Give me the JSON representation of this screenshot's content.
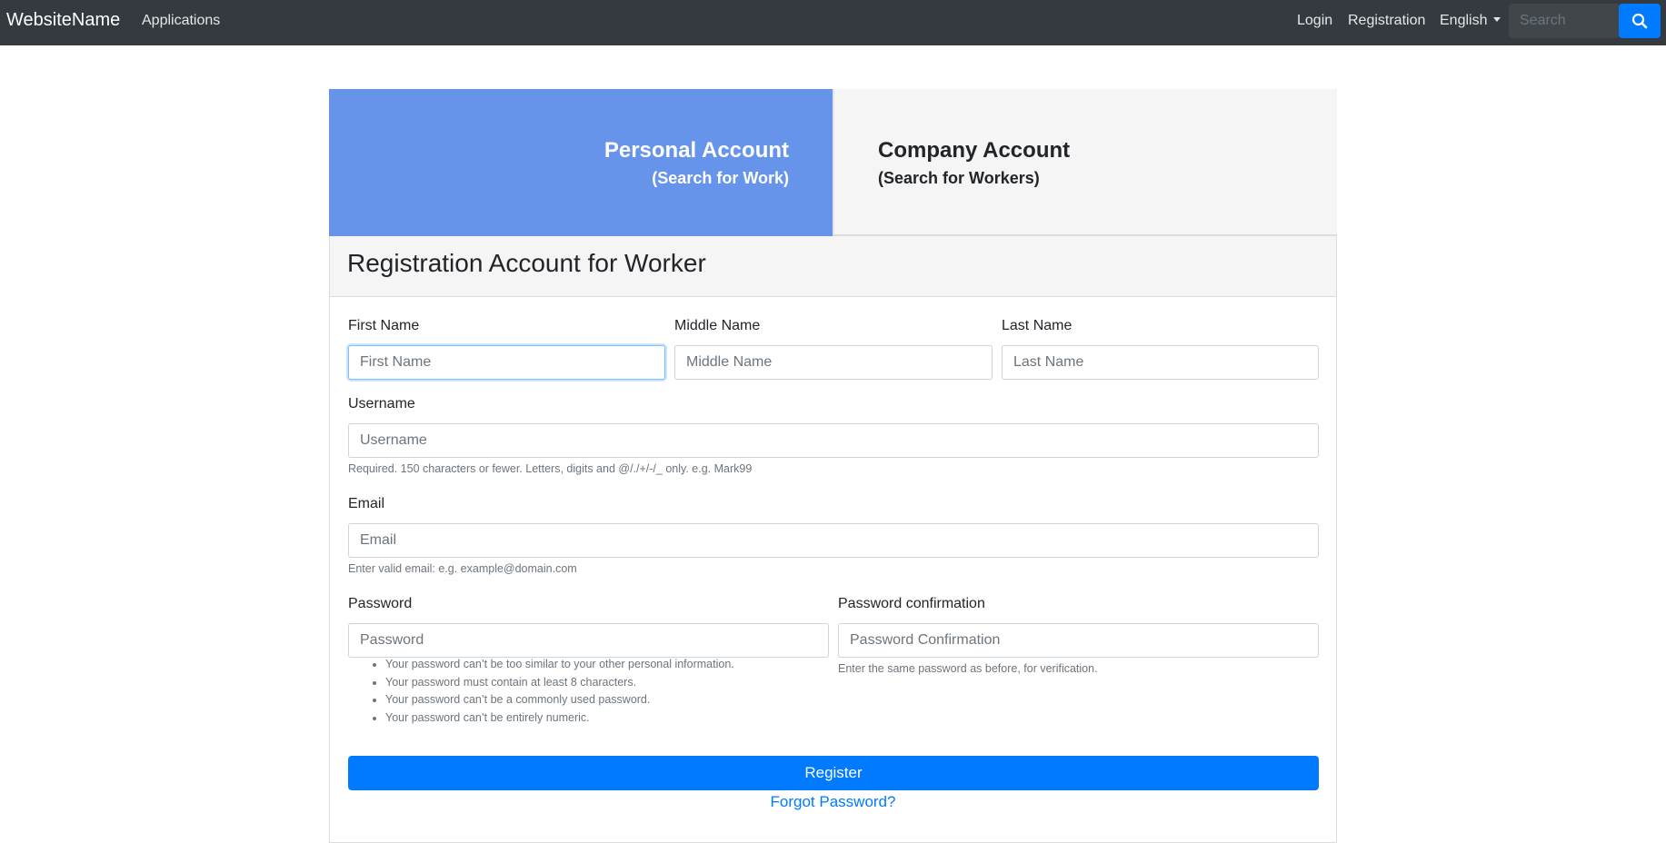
{
  "navbar": {
    "brand": "WebsiteName",
    "applications": "Applications",
    "login": "Login",
    "registration": "Registration",
    "language": "English",
    "search_placeholder": "Search",
    "search_icon": "search-icon"
  },
  "tabs": {
    "personal": {
      "title": "Personal Account",
      "subtitle": "(Search for Work)"
    },
    "company": {
      "title": "Company Account",
      "subtitle": "(Search for Workers)"
    }
  },
  "form": {
    "heading": "Registration Account for Worker",
    "first_name": {
      "label": "First Name",
      "placeholder": "First Name"
    },
    "middle_name": {
      "label": "Middle Name",
      "placeholder": "Middle Name"
    },
    "last_name": {
      "label": "Last Name",
      "placeholder": "Last Name"
    },
    "username": {
      "label": "Username",
      "placeholder": "Username",
      "help": "Required. 150 characters or fewer. Letters, digits and @/./+/-/_ only. e.g. Mark99"
    },
    "email": {
      "label": "Email",
      "placeholder": "Email",
      "help": "Enter valid email: e.g. example@domain.com"
    },
    "password": {
      "label": "Password",
      "placeholder": "Password",
      "rules": [
        "Your password can’t be too similar to your other personal information.",
        "Your password must contain at least 8 characters.",
        "Your password can’t be a commonly used password.",
        "Your password can’t be entirely numeric."
      ]
    },
    "password_confirmation": {
      "label": "Password confirmation",
      "placeholder": "Password Confirmation",
      "help": "Enter the same password as before, for verification."
    },
    "register_label": "Register",
    "forgot_label": "Forgot Password?"
  },
  "colors": {
    "navbar": "#343a40",
    "personal_tab": "#6694ea",
    "primary": "#007bff"
  }
}
